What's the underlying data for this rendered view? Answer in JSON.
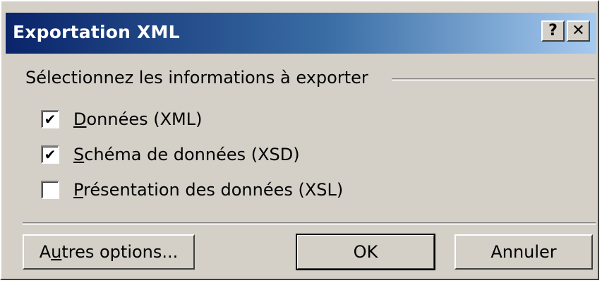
{
  "dialog": {
    "title": "Exportation XML",
    "help_label": "?",
    "close_label": "✕"
  },
  "group": {
    "label": "Sélectionnez les informations à exporter"
  },
  "options": [
    {
      "label_pre": "",
      "label_key": "D",
      "label_rest": "onnées (XML)",
      "checked": true,
      "mark": "✔"
    },
    {
      "label_pre": "",
      "label_key": "S",
      "label_rest": "chéma de données (XSD)",
      "checked": true,
      "mark": "✔"
    },
    {
      "label_pre": "",
      "label_key": "P",
      "label_rest": "résentation des données (XSL)",
      "checked": false,
      "mark": ""
    }
  ],
  "buttons": {
    "more_pre": "A",
    "more_key": "u",
    "more_rest": "tres options...",
    "ok": "OK",
    "cancel": "Annuler"
  }
}
